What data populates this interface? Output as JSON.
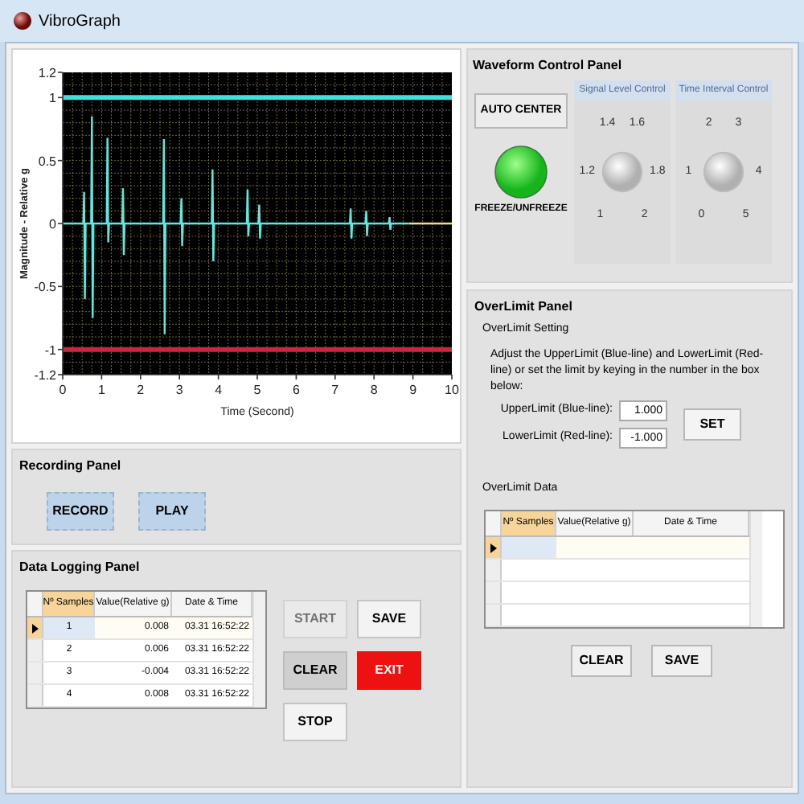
{
  "window": {
    "title": "VibroGraph"
  },
  "chart": {
    "chart_data": {
      "type": "line",
      "xlabel": "Time (Second)",
      "ylabel": "Magnitude - Relative g",
      "grid": true,
      "xlim": [
        0,
        10
      ],
      "ylim": [
        -1.2,
        1.2
      ],
      "xticks": [
        0,
        1,
        2,
        3,
        4,
        5,
        6,
        7,
        8,
        9,
        10
      ],
      "yticks": [
        -1.2,
        -1,
        -0.5,
        0,
        0.5,
        1,
        1.2
      ],
      "x": [
        0,
        0.53,
        0.55,
        0.57,
        0.59,
        0.73,
        0.75,
        0.77,
        0.79,
        1.13,
        1.15,
        1.17,
        1.19,
        1.53,
        1.55,
        1.57,
        1.59,
        2.58,
        2.6,
        2.62,
        2.64,
        3.03,
        3.05,
        3.07,
        3.09,
        3.83,
        3.85,
        3.87,
        3.89,
        4.73,
        4.75,
        4.77,
        4.79,
        5.03,
        5.05,
        5.07,
        5.09,
        7.38,
        7.4,
        7.42,
        7.44,
        7.78,
        7.8,
        7.82,
        7.84,
        8.38,
        8.4,
        8.42,
        8.44,
        8.9,
        10
      ],
      "series": [
        {
          "color": "#5fe8e0",
          "values": [
            0,
            0,
            0.25,
            -0.6,
            0,
            0,
            0.85,
            -0.75,
            0,
            0,
            0.68,
            -0.15,
            0,
            0,
            0.28,
            -0.25,
            0,
            0,
            0.67,
            -0.88,
            0,
            0,
            0.2,
            -0.18,
            0,
            0,
            0.43,
            -0.3,
            0,
            0,
            0.27,
            -0.1,
            0,
            0,
            0.15,
            -0.12,
            0,
            0,
            0.12,
            -0.12,
            0,
            0,
            0.1,
            -0.1,
            0,
            0,
            0.05,
            -0.05,
            0,
            0,
            null
          ]
        },
        {
          "color": "#e8e08a",
          "values": [
            null,
            null,
            null,
            null,
            null,
            null,
            null,
            null,
            null,
            null,
            null,
            null,
            null,
            null,
            null,
            null,
            null,
            null,
            null,
            null,
            null,
            null,
            null,
            null,
            null,
            null,
            null,
            null,
            null,
            null,
            null,
            null,
            null,
            null,
            null,
            null,
            null,
            null,
            null,
            null,
            null,
            null,
            null,
            null,
            null,
            null,
            null,
            null,
            null,
            0,
            0
          ]
        }
      ],
      "ref_lines": [
        {
          "axis": "y",
          "value": 1,
          "color": "#3fe0dc"
        },
        {
          "axis": "y",
          "value": -1,
          "color": "#c8283f"
        }
      ]
    }
  },
  "waveform_control_panel": {
    "title": "Waveform Control Panel",
    "auto_center_button": "AUTO CENTER",
    "freeze_button": {
      "label": "FREEZE/UNFREEZE",
      "on": true
    },
    "knobs": [
      {
        "title": "Signal Level Control",
        "scale": [
          "1",
          "1.2",
          "1.4",
          "1.6",
          "1.8",
          "2"
        ]
      },
      {
        "title": "Time Interval Control",
        "scale": [
          "0",
          "1",
          "2",
          "3",
          "4",
          "5"
        ]
      }
    ]
  },
  "overlimit_panel": {
    "title": "OverLimit Panel",
    "setting_title": "OverLimit Setting",
    "instructions": "Adjust the UpperLimit (Blue-line) and LowerLimit (Red-line) or set the limit by keying in the number in the box below:",
    "fields": [
      {
        "label": "UpperLimit (Blue-line):",
        "value": "1.000"
      },
      {
        "label": "LowerLimit (Red-line):",
        "value": "-1.000"
      }
    ],
    "set_button": "SET",
    "data_title": "OverLimit Data",
    "columns": [
      "Nº Samples",
      "Value(Relative g)",
      "Date & Time"
    ],
    "rows": [
      {
        "selected": true
      },
      {
        "selected": false
      },
      {
        "selected": false
      },
      {
        "selected": false
      }
    ],
    "buttons": [
      "CLEAR",
      "SAVE"
    ]
  },
  "recording_panel": {
    "title": "Recording Panel",
    "buttons": [
      "RECORD",
      "PLAY"
    ]
  },
  "data_logging_panel": {
    "title": "Data Logging Panel",
    "columns": [
      "Nº Samples",
      "Value(Relative g)",
      "Date & Time"
    ],
    "rows": [
      {
        "cells": [
          "1",
          "0.008",
          "03.31 16:52:22"
        ],
        "selected": true
      },
      {
        "cells": [
          "2",
          "0.006",
          "03.31 16:52:22"
        ],
        "selected": false
      },
      {
        "cells": [
          "3",
          "-0.004",
          "03.31 16:52:22"
        ],
        "selected": false
      },
      {
        "cells": [
          "4",
          "0.008",
          "03.31 16:52:22"
        ],
        "selected": false
      }
    ],
    "buttons": [
      {
        "label": "START",
        "kind": "normal",
        "disabled": true
      },
      {
        "label": "SAVE",
        "kind": "normal",
        "disabled": false
      },
      {
        "label": "CLEAR",
        "kind": "shaded",
        "disabled": false
      },
      {
        "label": "EXIT",
        "kind": "danger",
        "disabled": false
      },
      {
        "label": "STOP",
        "kind": "normal",
        "disabled": false
      }
    ]
  }
}
